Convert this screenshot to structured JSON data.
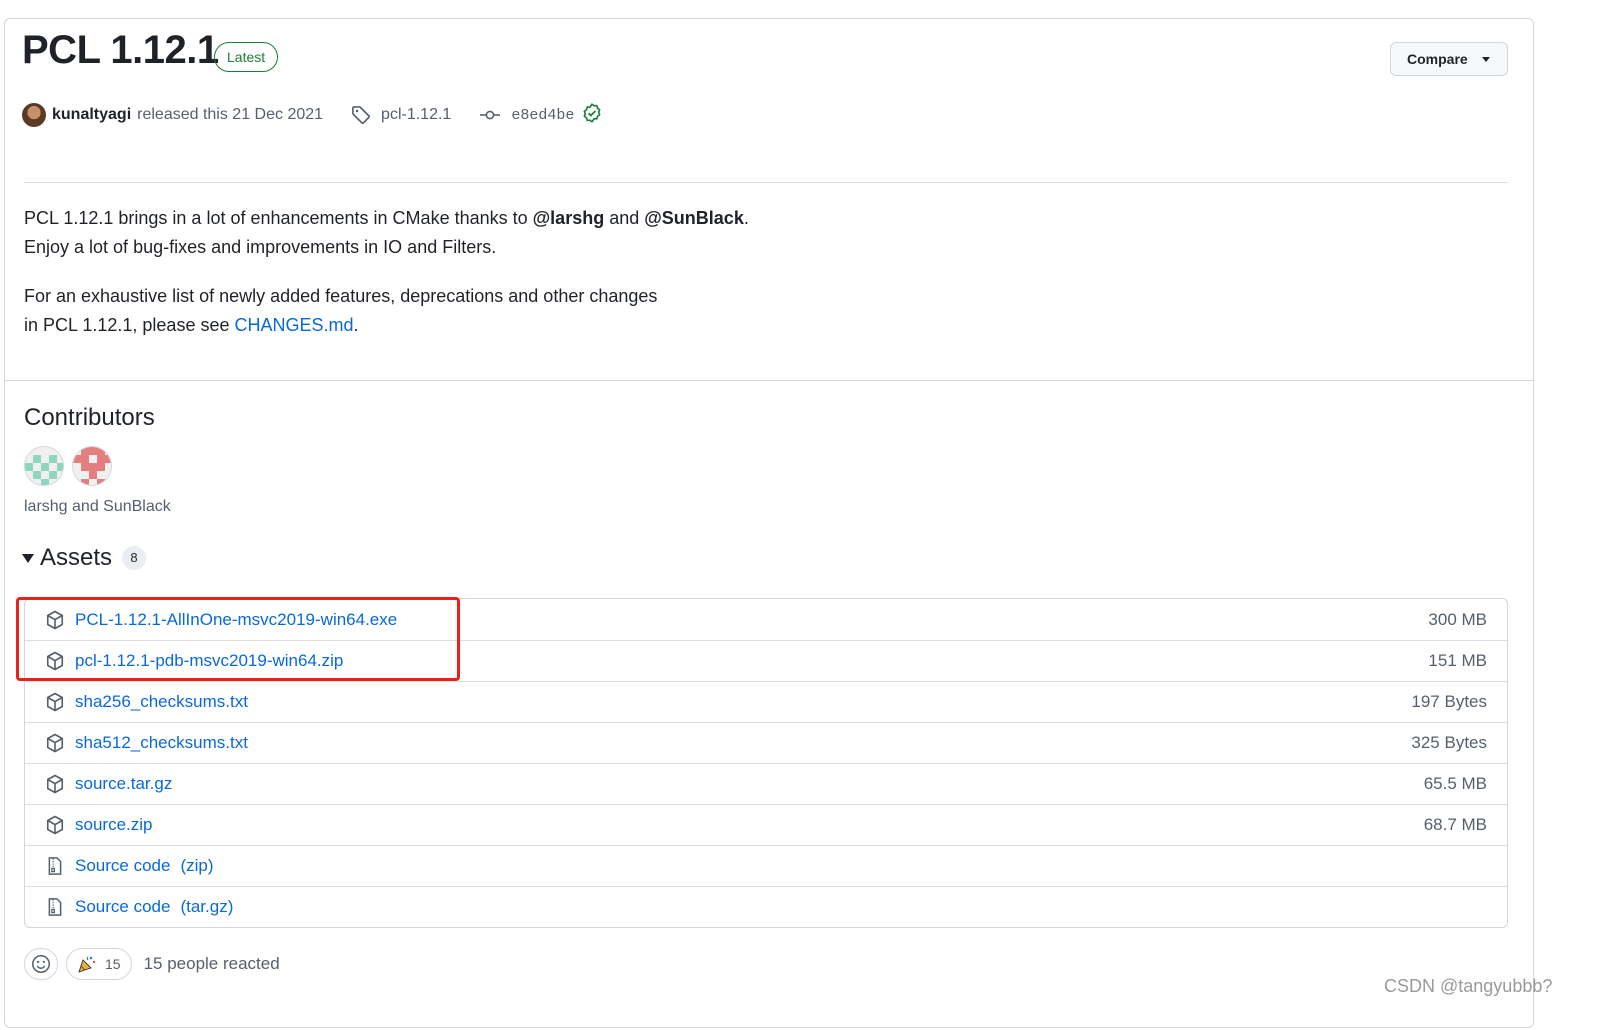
{
  "release": {
    "title": "PCL 1.12.1",
    "badge": "Latest",
    "compare_label": "Compare",
    "author": "kunaltyagi",
    "released_text": "released this 21 Dec 2021",
    "tag": "pcl-1.12.1",
    "commit": "e8ed4be"
  },
  "body": {
    "p1_a": "PCL 1.12.1 brings in a lot of enhancements in CMake thanks to ",
    "p1_mention1": "@larshg",
    "p1_and": " and ",
    "p1_mention2": "@SunBlack",
    "p1_end": ".",
    "p1_line2": "Enjoy a lot of bug-fixes and improvements in IO and Filters.",
    "p2_line1": "For an exhaustive list of newly added features, deprecations and other changes",
    "p2_line2_a": "in PCL 1.12.1, please see ",
    "p2_link": "CHANGES.md",
    "p2_end": "."
  },
  "contributors": {
    "heading": "Contributors",
    "names": "larshg and SunBlack"
  },
  "assets": {
    "heading": "Assets",
    "count": "8",
    "items": [
      {
        "name": "PCL-1.12.1-AllInOne-msvc2019-win64.exe",
        "size": "300 MB",
        "icon": "package-icon"
      },
      {
        "name": "pcl-1.12.1-pdb-msvc2019-win64.zip",
        "size": "151 MB",
        "icon": "package-icon"
      },
      {
        "name": "sha256_checksums.txt",
        "size": "197 Bytes",
        "icon": "package-icon"
      },
      {
        "name": "sha512_checksums.txt",
        "size": "325 Bytes",
        "icon": "package-icon"
      },
      {
        "name": "source.tar.gz",
        "size": "65.5 MB",
        "icon": "package-icon"
      },
      {
        "name": "source.zip",
        "size": "68.7 MB",
        "icon": "package-icon"
      },
      {
        "name": "Source code",
        "suffix": "(zip)",
        "icon": "file-zip-icon"
      },
      {
        "name": "Source code",
        "suffix": "(tar.gz)",
        "icon": "file-zip-icon"
      }
    ]
  },
  "reactions": {
    "tada_count": "15",
    "summary": "15 people reacted"
  },
  "watermark": "CSDN @tangyubbb?",
  "colors": {
    "link": "#0969da",
    "success": "#1a7f37",
    "highlight": "#e8221b"
  }
}
